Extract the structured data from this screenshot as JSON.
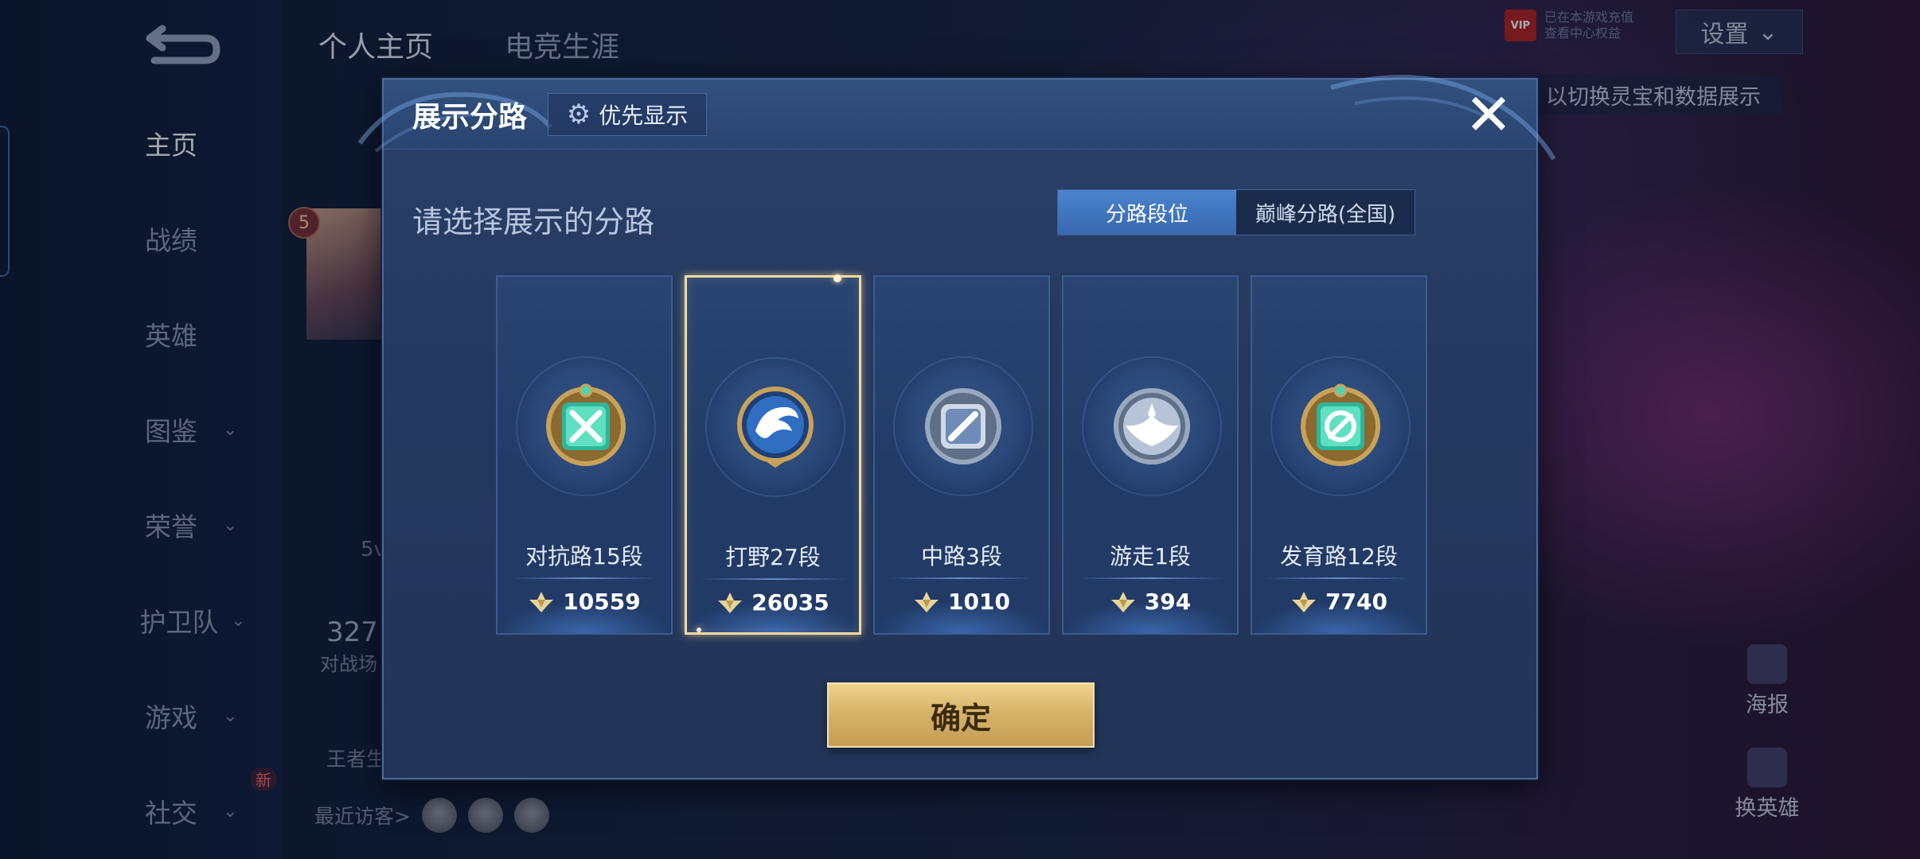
{
  "background": {
    "top_tabs": [
      "个人主页",
      "电竞生涯"
    ],
    "sidebar": [
      {
        "label": "主页",
        "chevron": false
      },
      {
        "label": "战绩",
        "chevron": false
      },
      {
        "label": "英雄",
        "chevron": false
      },
      {
        "label": "图鉴",
        "chevron": true
      },
      {
        "label": "荣誉",
        "chevron": true
      },
      {
        "label": "护卫队",
        "chevron": true
      },
      {
        "label": "游戏",
        "chevron": true
      },
      {
        "label": "社交",
        "chevron": true
      }
    ],
    "new_badge": "新",
    "settings_label": "设置",
    "vip_badge": "VIP",
    "vip_text_1": "已在本游戏充值",
    "vip_text_2": "查看中心权益",
    "hint_text": "以切换灵宝和数据展示",
    "level": "5",
    "peek_5v": "5v",
    "peek_count": "327",
    "peek_count_sub": "对战场",
    "peek_wang": "王者生",
    "recent_visitors": "最近访客>",
    "right_buttons": {
      "poster": "海报",
      "change_hero": "换英雄"
    }
  },
  "modal": {
    "title": "展示分路",
    "priority_label": "优先显示",
    "close_icon": "close-icon",
    "subtitle": "请选择展示的分路",
    "toggle": [
      {
        "label": "分路段位",
        "active": true
      },
      {
        "label": "巅峰分路(全国)",
        "active": false
      }
    ],
    "lanes": [
      {
        "name": "对抗路15段",
        "score": "10559",
        "selected": false,
        "emblem": "clash-lane-icon"
      },
      {
        "name": "打野27段",
        "score": "26035",
        "selected": true,
        "emblem": "jungle-icon"
      },
      {
        "name": "中路3段",
        "score": "1010",
        "selected": false,
        "emblem": "mid-lane-icon"
      },
      {
        "name": "游走1段",
        "score": "394",
        "selected": false,
        "emblem": "roam-icon"
      },
      {
        "name": "发育路12段",
        "score": "7740",
        "selected": false,
        "emblem": "farm-lane-icon"
      }
    ],
    "confirm_label": "确定"
  },
  "colors": {
    "accent_blue": "#3868ad",
    "gold": "#d7b46a",
    "selected_border": "#f2d9a2"
  }
}
